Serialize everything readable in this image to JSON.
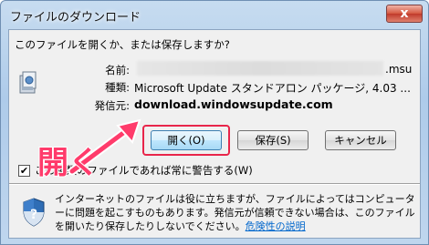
{
  "window": {
    "title": "ファイルのダウンロード",
    "close_glyph": "x"
  },
  "dialog": {
    "question": "このファイルを開くか、または保存しますか?",
    "name_label": "名前:",
    "name_suffix": ".msu",
    "type_label": "種類:",
    "type_value": "Microsoft Update スタンドアロン パッケージ, 4.03 ...",
    "source_label": "発信元:",
    "source_value": "download.windowsupdate.com"
  },
  "buttons": {
    "open": "開く(O)",
    "save": "保存(S)",
    "cancel": "キャンセル"
  },
  "checkbox": {
    "checked": true,
    "label": "この種類のファイルであれば常に警告する(W)"
  },
  "warning": {
    "text": "インターネットのファイルは役に立ちますが、ファイルによってはコンピューターに問題を起こすものもあります。発信元が信頼できない場合は、このファイルを開いたり保存したりしないでください。",
    "link": "危険性の説明"
  },
  "annotation": {
    "text": "開く",
    "color": "#ff3b6b"
  },
  "colors": {
    "highlight": "#e8254a",
    "link": "#0066cc"
  },
  "icons": [
    "file-icon",
    "shield-icon",
    "close-icon"
  ]
}
